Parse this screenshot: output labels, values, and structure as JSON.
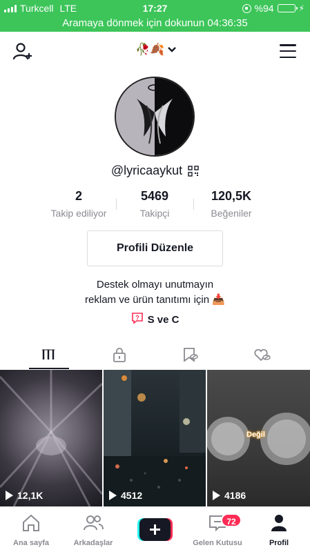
{
  "status_bar": {
    "carrier": "Turkcell",
    "network": "LTE",
    "time": "17:27",
    "battery": "%94",
    "battery_level": 0.94
  },
  "return_bar": {
    "text": "Aramaya dönmek için dokunun 04:36:35"
  },
  "top_nav": {
    "account_emoji": "🥀🍂"
  },
  "profile": {
    "username": "@lyricaaykut",
    "stats": [
      {
        "value": "2",
        "label": "Takip ediliyor"
      },
      {
        "value": "5469",
        "label": "Takipçi"
      },
      {
        "value": "120,5K",
        "label": "Beğeniler"
      }
    ],
    "edit_button": "Profili Düzenle",
    "bio_line1": "Destek olmayı unutmayın",
    "bio_line2": "reklam ve ürün tanıtımı için 📥",
    "link_text": "S ve C"
  },
  "videos": [
    {
      "views": "12,1K"
    },
    {
      "views": "4512"
    },
    {
      "views": "4186",
      "overlay_text": "Değil"
    }
  ],
  "bottom_nav": {
    "home": "Ana sayfa",
    "friends": "Arkadaşlar",
    "inbox": "Gelen Kutusu",
    "inbox_badge": "72",
    "profile": "Profil"
  },
  "colors": {
    "status_green": "#3dc55a",
    "badge_red": "#fe2c55",
    "text_primary": "#161823",
    "text_secondary": "#8a8b91"
  }
}
